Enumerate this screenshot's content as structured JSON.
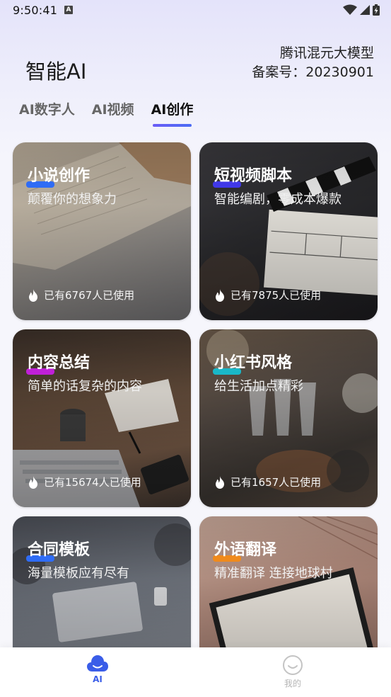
{
  "status_bar": {
    "time": "9:50:41",
    "notif_icon": "A"
  },
  "header": {
    "title": "智能AI",
    "filing_line1": "腾讯混元大模型",
    "filing_line2": "备案号：20230901"
  },
  "tabs": [
    {
      "label": "AI数字人",
      "active": false
    },
    {
      "label": "AI视频",
      "active": false
    },
    {
      "label": "AI创作",
      "active": true
    }
  ],
  "cards": [
    {
      "title": "小说创作",
      "subtitle": "颠覆你的想象力",
      "usage": "已有6767人已使用",
      "highlight": "#2f6cf5"
    },
    {
      "title": "短视频脚本",
      "subtitle": "智能编剧，零成本爆款",
      "usage": "已有7875人已使用",
      "highlight": "#4038e8"
    },
    {
      "title": "内容总结",
      "subtitle": "简单的话复杂的内容",
      "usage": "已有15674人已使用",
      "highlight": "#c020d8"
    },
    {
      "title": "小红书风格",
      "subtitle": "给生活加点精彩",
      "usage": "已有1657人已使用",
      "highlight": "#19b8c8"
    },
    {
      "title": "合同模板",
      "subtitle": "海量模板应有尽有",
      "usage": "",
      "highlight": "#2f6cf5"
    },
    {
      "title": "外语翻译",
      "subtitle": "精准翻译 连接地球村",
      "usage": "",
      "highlight": "#f08a1c"
    }
  ],
  "bottom_nav": {
    "ai_label": "AI",
    "mine_label": "我的"
  }
}
